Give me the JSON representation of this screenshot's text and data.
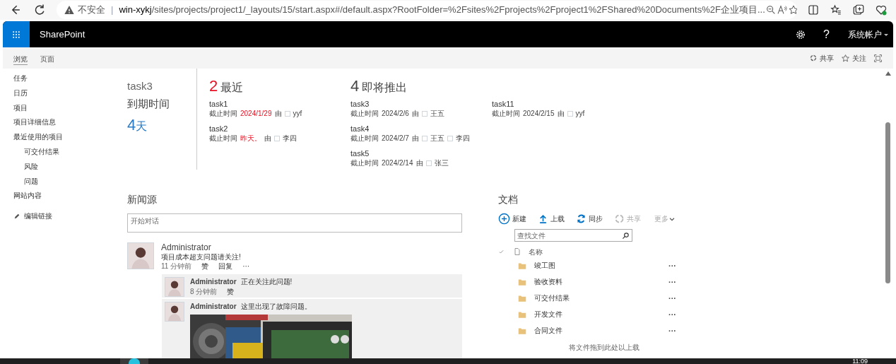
{
  "browser": {
    "security": "不安全",
    "separator": "|",
    "url_host": "win-xykj",
    "url_rest": "/sites/projects/project1/_layouts/15/start.aspx#/default.aspx?RootFolder=%2Fsites%2Fprojects%2Fproject1%2FShared%20Documents%2F企业项目..."
  },
  "header": {
    "app": "SharePoint",
    "help": "?",
    "user": "系统帐户"
  },
  "ribbon": {
    "tabs": [
      {
        "label": "浏览",
        "selected": true
      },
      {
        "label": "页面",
        "selected": false
      }
    ],
    "actions": [
      "共享",
      "关注"
    ]
  },
  "nav": {
    "items": [
      {
        "label": "任务"
      },
      {
        "label": "日历"
      },
      {
        "label": "项目"
      },
      {
        "label": "项目详细信息"
      },
      {
        "label": "最近使用的项目",
        "children": [
          {
            "label": "可交付结果"
          },
          {
            "label": "风险"
          },
          {
            "label": "问题"
          }
        ]
      },
      {
        "label": "网站内容"
      }
    ],
    "edit_link": "编辑链接"
  },
  "countdown": {
    "task": "task3",
    "label": "到期时间",
    "number": "4",
    "unit": "天"
  },
  "recent": {
    "count": "2",
    "title": "最近",
    "tasks": [
      {
        "name": "task1",
        "due_label": "截止时间",
        "due": "2024/1/29",
        "overdue": true,
        "by": "由",
        "people": [
          "yyf"
        ]
      },
      {
        "name": "task2",
        "due_label": "截止时间",
        "due": "昨天。",
        "overdue": true,
        "by": "由",
        "people": [
          "李四"
        ]
      }
    ]
  },
  "upcoming": {
    "count": "4",
    "title": "即将推出",
    "tasks": [
      {
        "name": "task3",
        "due_label": "截止时间",
        "due": "2024/2/6",
        "overdue": false,
        "by": "由",
        "people": [
          "王五"
        ]
      },
      {
        "name": "task4",
        "due_label": "截止时间",
        "due": "2024/2/7",
        "overdue": false,
        "by": "由",
        "people": [
          "王五",
          "李四"
        ]
      },
      {
        "name": "task5",
        "due_label": "截止时间",
        "due": "2024/2/14",
        "overdue": false,
        "by": "由",
        "people": [
          "张三"
        ]
      },
      {
        "name": "task11",
        "due_label": "截止时间",
        "due": "2024/2/15",
        "overdue": false,
        "by": "由",
        "people": [
          "yyf"
        ]
      }
    ]
  },
  "newsfeed": {
    "title": "新闻源",
    "placeholder": "开始对话",
    "post": {
      "author": "Administrator",
      "text": "项目成本超支问题请关注!",
      "time": "11 分钟前",
      "actions": [
        "赞",
        "回复",
        "···"
      ]
    },
    "replies": [
      {
        "author": "Administrator",
        "text": "正在关注此问题!",
        "time": "8 分钟前",
        "actions": [
          "赞"
        ],
        "has_picture": false
      },
      {
        "author": "Administrator",
        "text": "这里出现了故障问题。",
        "has_picture": true
      }
    ]
  },
  "documents": {
    "title": "文档",
    "toolbar": [
      {
        "kind": "new",
        "label": "新建",
        "disabled": false
      },
      {
        "kind": "upload",
        "label": "上载",
        "disabled": false
      },
      {
        "kind": "sync",
        "label": "同步",
        "disabled": false
      },
      {
        "kind": "share",
        "label": "共享",
        "disabled": true
      },
      {
        "kind": "more",
        "label": "更多",
        "disabled": true
      }
    ],
    "search_placeholder": "查找文件",
    "column": "名称",
    "folders": [
      {
        "name": "竣工图",
        "menu": "···"
      },
      {
        "name": "验收资料",
        "menu": "···"
      },
      {
        "name": "可交付结果",
        "menu": "···"
      },
      {
        "name": "开发文件",
        "menu": "···"
      },
      {
        "name": "合同文件",
        "menu": "···"
      }
    ],
    "drop_hint": "将文件拖到此处以上载"
  },
  "taskbar": {
    "clock": "11:09"
  }
}
